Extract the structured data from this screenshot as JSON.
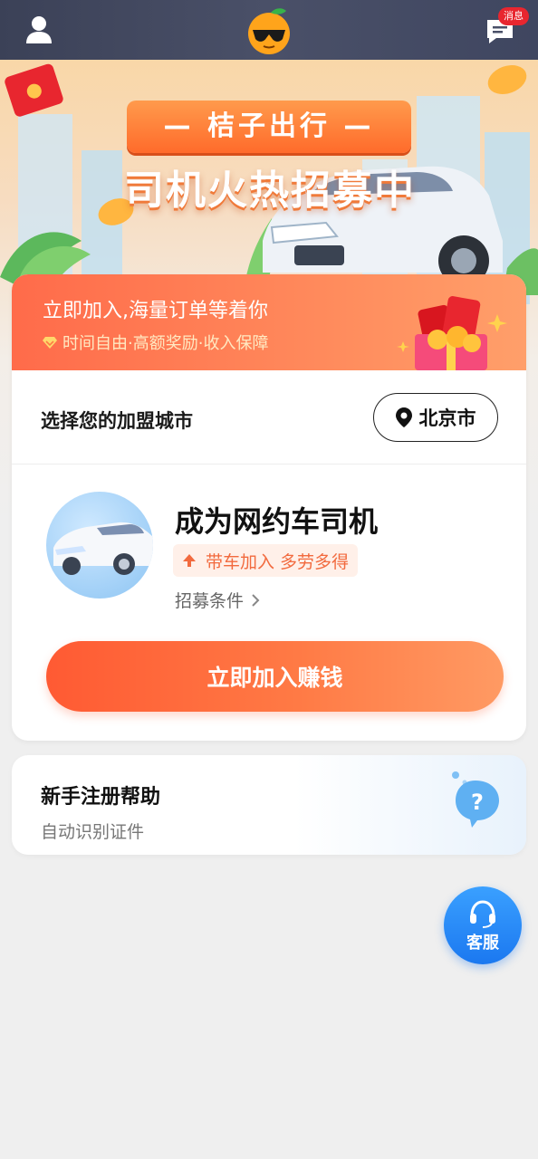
{
  "header": {
    "user_icon": "user-icon",
    "logo_icon": "orange-mascot-logo",
    "message_icon": "message-icon",
    "message_badge": "消息"
  },
  "banner": {
    "ribbon_text": "— 桔子出行 —",
    "headline": "司机火热招募中"
  },
  "promo": {
    "title": "立即加入,海量订单等着你",
    "subtitle": "时间自由·高额奖励·收入保障"
  },
  "city": {
    "label": "选择您的加盟城市",
    "selected_city": "北京市"
  },
  "driver": {
    "title": "成为网约车司机",
    "tag": "带车加入 多劳多得",
    "requirements_link": "招募条件",
    "join_button": "立即加入赚钱"
  },
  "help": {
    "title": "新手注册帮助",
    "subtitle": "自动识别证件"
  },
  "service": {
    "label": "客服"
  },
  "colors": {
    "header_bg": "#434a62",
    "accent_orange": "#ff6b3d",
    "service_blue": "#1b78f0",
    "page_bg": "#efefef"
  }
}
